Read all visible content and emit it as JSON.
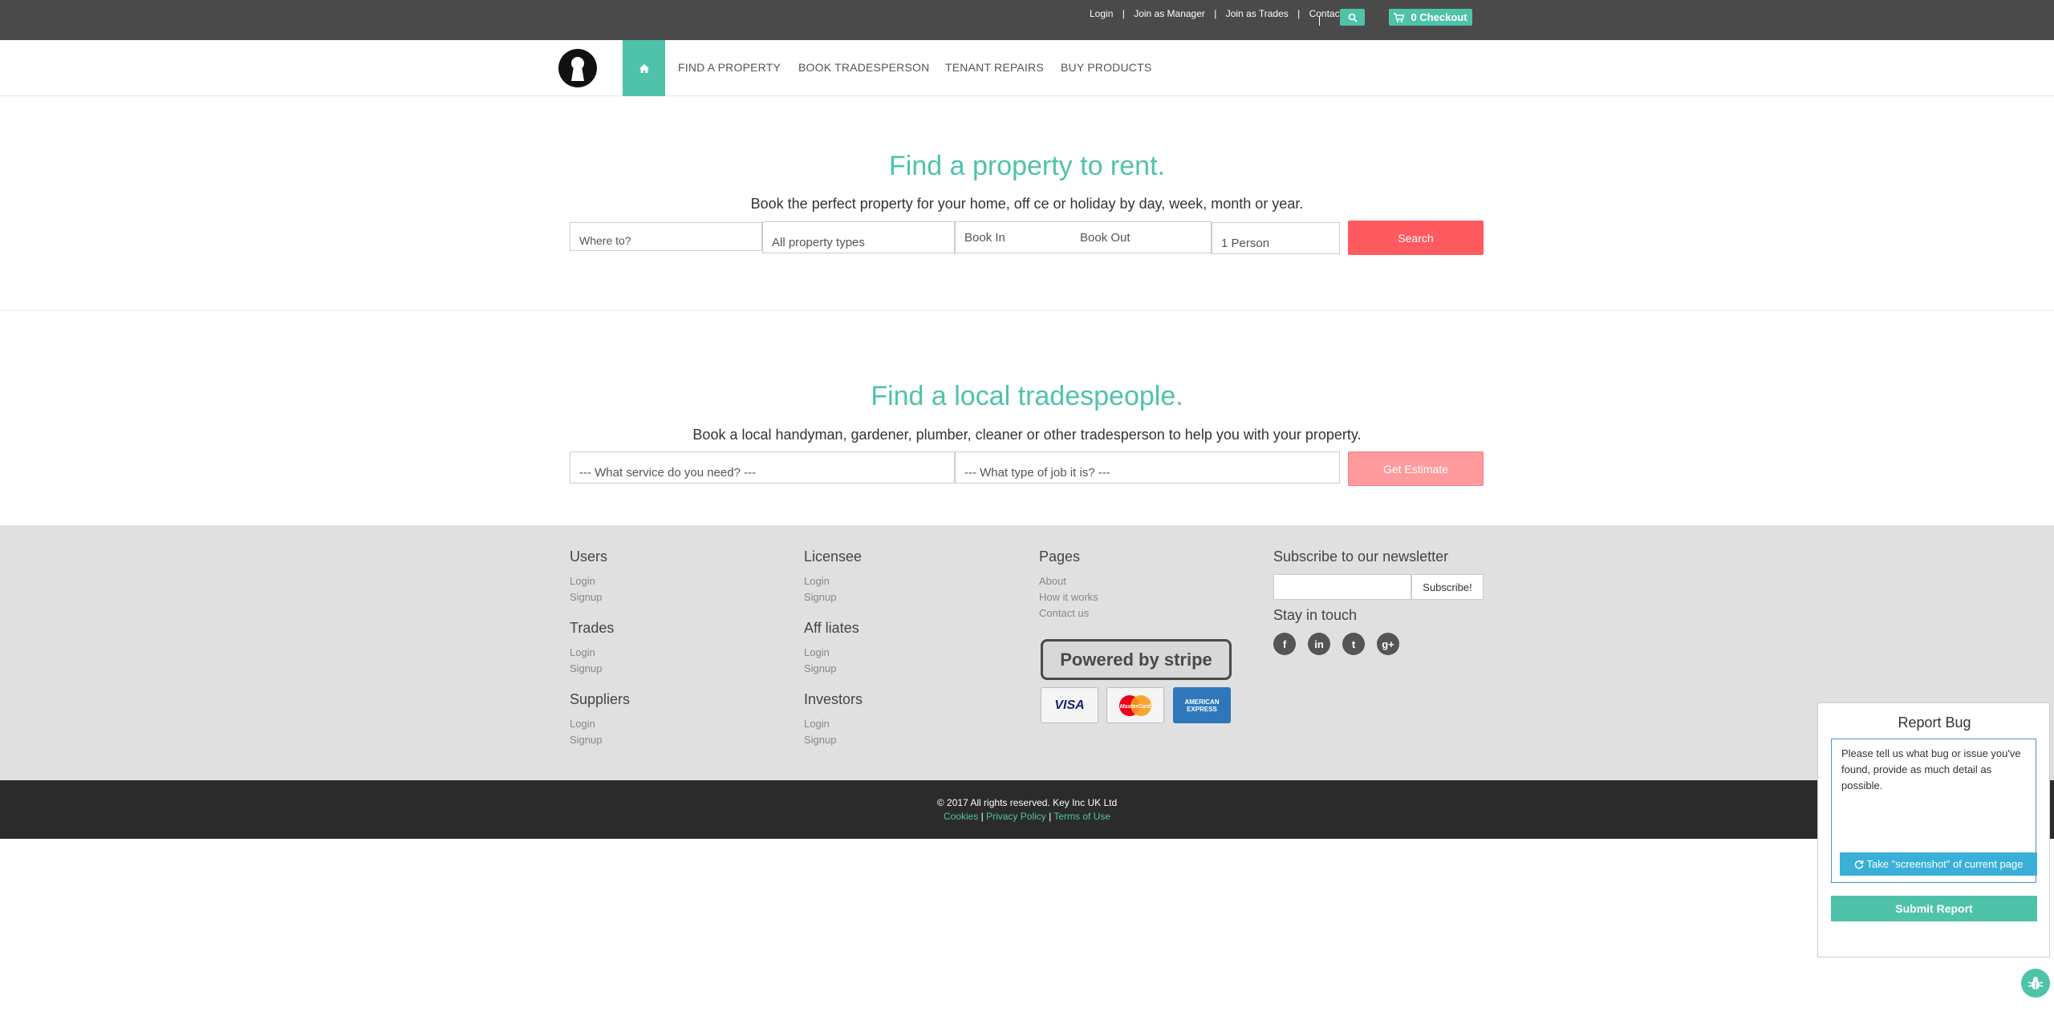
{
  "topbar": {
    "links": [
      "Login",
      "Join as Manager",
      "Join as Trades",
      "Contact"
    ],
    "separator": "|",
    "checkout_label": "0 Checkout"
  },
  "nav": {
    "items": [
      "FIND A PROPERTY",
      "BOOK TRADESPERSON",
      "TENANT REPAIRS",
      "BUY PRODUCTS"
    ]
  },
  "property": {
    "title": "Find a property to rent.",
    "subtitle": "Book the perfect property for your home, off ce or holiday by day, week, month or year.",
    "where_placeholder": "Where to?",
    "type_value": "All property types",
    "book_in": "Book In",
    "book_out": "Book Out",
    "guests": "1 Person",
    "search_label": "Search"
  },
  "trades": {
    "title": "Find a local tradespeople.",
    "subtitle": "Book a local handyman, gardener, plumber, cleaner or other tradesperson to help you with your property.",
    "service_value": "--- What service do you need? ---",
    "job_value": "--- What type of job it is? ---",
    "estimate_label": "Get Estimate"
  },
  "footer": {
    "groups": [
      {
        "title": "Users",
        "links": [
          "Login",
          "Signup"
        ]
      },
      {
        "title": "Trades",
        "links": [
          "Login",
          "Signup"
        ]
      },
      {
        "title": "Suppliers",
        "links": [
          "Login",
          "Signup"
        ]
      },
      {
        "title": "Licensee",
        "links": [
          "Login",
          "Signup"
        ]
      },
      {
        "title": "Aff liates",
        "links": [
          "Login",
          "Signup"
        ]
      },
      {
        "title": "Investors",
        "links": [
          "Login",
          "Signup"
        ]
      },
      {
        "title": "Pages",
        "links": [
          "About",
          "How it works",
          "Contact us"
        ]
      }
    ],
    "newsletter_title": "Subscribe to our newsletter",
    "subscribe_label": "Subscribe!",
    "stay_title": "Stay in touch",
    "stripe_label": "Powered by stripe",
    "cards": [
      "VISA",
      "MasterCard",
      "AMERICAN EXPRESS"
    ],
    "copyright": "© 2017 All rights reserved. Key Inc UK Ltd",
    "legal": [
      "Cookies",
      "Privacy Policy",
      "Terms of Use"
    ]
  },
  "bug": {
    "title": "Report Bug",
    "text": "Please tell us what bug or issue you've found, provide as much detail as possible.",
    "screenshot_label": "Take \"screenshot\" of current page",
    "submit_label": "Submit Report"
  },
  "colors": {
    "accent": "#4fc3a9",
    "cta": "#ff5a5f",
    "topbar": "#4a4a4a",
    "footer": "#e0e0e0"
  }
}
